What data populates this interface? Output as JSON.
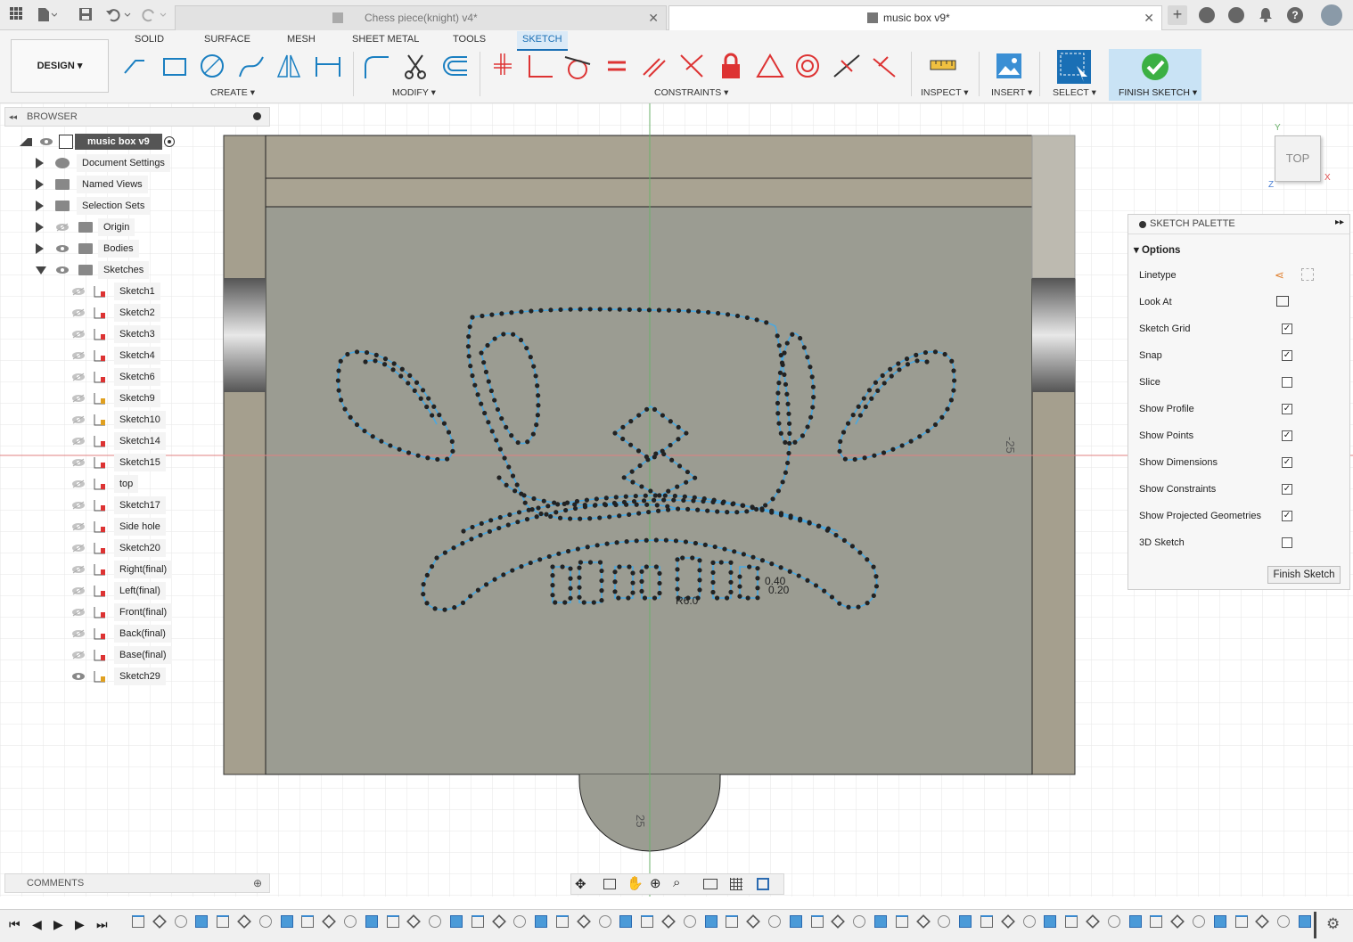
{
  "titlebar": {
    "tabs": [
      {
        "label": "Chess piece(knight) v4*",
        "active": false
      },
      {
        "label": "music box v9*",
        "active": true
      }
    ]
  },
  "ribbon": {
    "design_label": "DESIGN",
    "tabs": [
      "SOLID",
      "SURFACE",
      "MESH",
      "SHEET METAL",
      "TOOLS",
      "SKETCH"
    ],
    "active_tab": "SKETCH",
    "groups": {
      "create": "CREATE",
      "modify": "MODIFY",
      "constraints": "CONSTRAINTS",
      "inspect": "INSPECT",
      "insert": "INSERT",
      "select": "SELECT",
      "finish": "FINISH SKETCH"
    }
  },
  "browser": {
    "title": "BROWSER",
    "root": "music box v9",
    "items": [
      {
        "label": "Document Settings"
      },
      {
        "label": "Named Views"
      },
      {
        "label": "Selection Sets"
      },
      {
        "label": "Origin"
      },
      {
        "label": "Bodies"
      },
      {
        "label": "Sketches"
      }
    ],
    "sketches": [
      "Sketch1",
      "Sketch2",
      "Sketch3",
      "Sketch4",
      "Sketch6",
      "Sketch9",
      "Sketch10",
      "Sketch14",
      "Sketch15",
      "top",
      "Sketch17",
      "Side hole",
      "Sketch20",
      "Right(final)",
      "Left(final)",
      "Front(final)",
      "Back(final)",
      "Base(final)",
      "Sketch29"
    ]
  },
  "comments": {
    "title": "COMMENTS"
  },
  "viewcube": {
    "face": "TOP",
    "axis_y": "Y",
    "axis_x": "X",
    "axis_z": "Z"
  },
  "canvas": {
    "dim_right": "-25",
    "dim_bottom": "25",
    "dim_small1": "0.40",
    "dim_small2": "R6.0",
    "dim_small3": "0.20"
  },
  "palette": {
    "title": "SKETCH PALETTE",
    "section": "Options",
    "rows": [
      {
        "label": "Linetype",
        "type": "icons"
      },
      {
        "label": "Look At",
        "type": "icon"
      },
      {
        "label": "Sketch Grid",
        "checked": true
      },
      {
        "label": "Snap",
        "checked": true
      },
      {
        "label": "Slice",
        "checked": false
      },
      {
        "label": "Show Profile",
        "checked": true
      },
      {
        "label": "Show Points",
        "checked": true
      },
      {
        "label": "Show Dimensions",
        "checked": true
      },
      {
        "label": "Show Constraints",
        "checked": true
      },
      {
        "label": "Show Projected Geometries",
        "checked": true
      },
      {
        "label": "3D Sketch",
        "checked": false
      }
    ],
    "finish_button": "Finish Sketch"
  }
}
